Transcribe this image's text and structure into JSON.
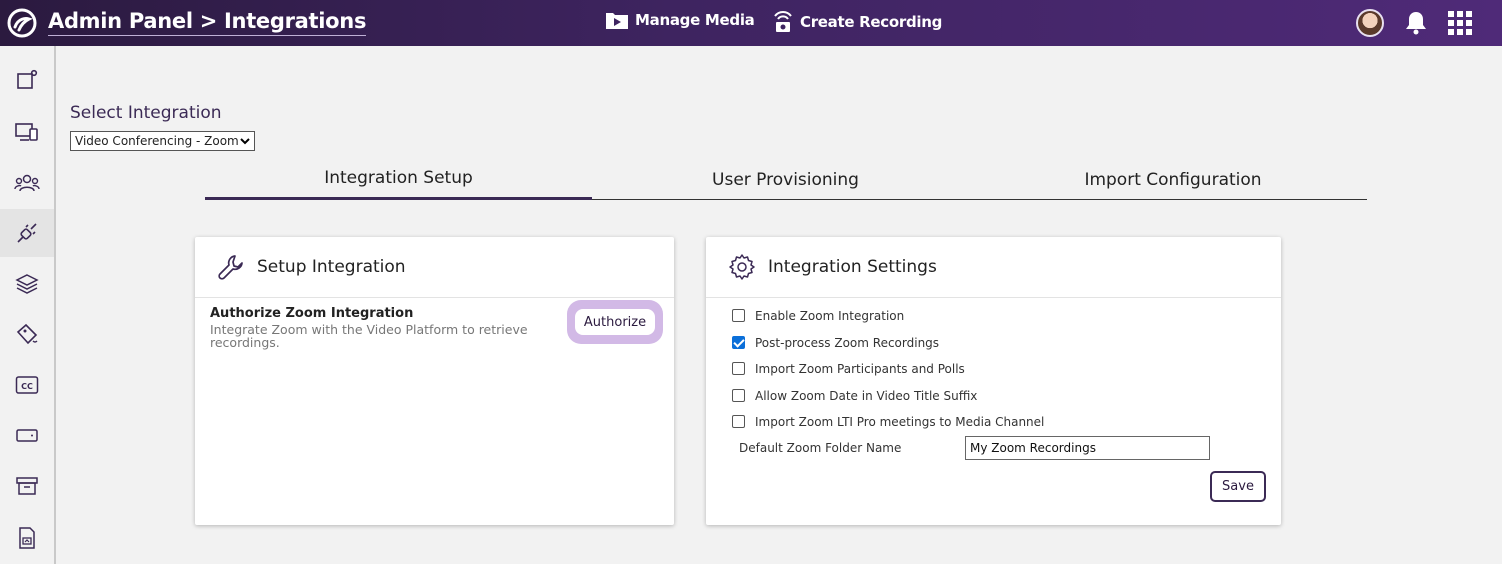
{
  "header": {
    "title": "Admin Panel > Integrations",
    "nav": [
      {
        "label": "Manage Media",
        "icon": "media-folder-icon"
      },
      {
        "label": "Create Recording",
        "icon": "broadcast-icon"
      }
    ],
    "icons": [
      "logo-icon",
      "avatar",
      "bell-icon",
      "apps-grid-icon"
    ]
  },
  "sidebar": {
    "items": [
      {
        "name": "dashboard",
        "icon": "dashboard-icon"
      },
      {
        "name": "devices",
        "icon": "devices-icon"
      },
      {
        "name": "users",
        "icon": "users-icon"
      },
      {
        "name": "integrations",
        "icon": "plug-icon",
        "active": true
      },
      {
        "name": "layers",
        "icon": "layers-icon"
      },
      {
        "name": "tags",
        "icon": "tag-icon"
      },
      {
        "name": "captions",
        "icon": "cc-icon"
      },
      {
        "name": "storage",
        "icon": "drive-icon"
      },
      {
        "name": "archive",
        "icon": "archive-icon"
      },
      {
        "name": "reports",
        "icon": "file-chart-icon"
      }
    ]
  },
  "select_integration": {
    "label": "Select Integration",
    "selected": "Video Conferencing - Zoom"
  },
  "tabs": [
    {
      "label": "Integration Setup",
      "active": true
    },
    {
      "label": "User Provisioning",
      "active": false
    },
    {
      "label": "Import Configuration",
      "active": false
    }
  ],
  "setup_card": {
    "title": "Setup Integration",
    "icon": "wrench-icon",
    "authorize_title": "Authorize Zoom Integration",
    "authorize_desc": "Integrate Zoom with the Video Platform to retrieve recordings.",
    "authorize_button": "Authorize"
  },
  "settings_card": {
    "title": "Integration Settings",
    "icon": "gear-icon",
    "options": [
      {
        "label": "Enable Zoom Integration",
        "checked": false
      },
      {
        "label": "Post-process Zoom Recordings",
        "checked": true
      },
      {
        "label": "Import Zoom Participants and Polls",
        "checked": false
      },
      {
        "label": "Allow Zoom Date in Video Title Suffix",
        "checked": false
      },
      {
        "label": "Import Zoom LTI Pro meetings to Media Channel",
        "checked": false
      }
    ],
    "folder_label": "Default Zoom Folder Name",
    "folder_value": "My Zoom Recordings",
    "save_button": "Save"
  },
  "colors": {
    "header_start": "#2b1a3f",
    "header_end": "#4f2a78",
    "accent": "#3b2a55",
    "authorize_highlight": "#d2b9e6",
    "checkbox_checked": "#0b6fd9"
  }
}
